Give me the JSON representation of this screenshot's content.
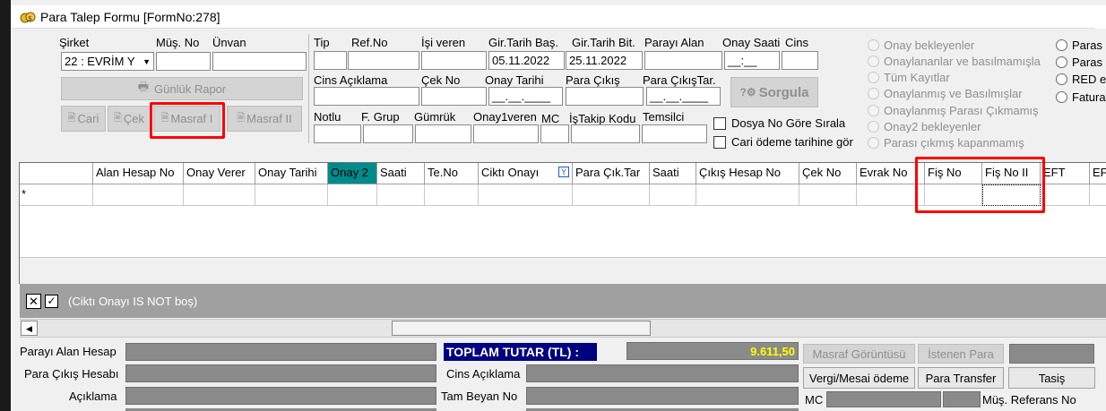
{
  "window": {
    "title": "Para Talep Formu [FormNo:278]"
  },
  "form": {
    "sirket_label": "Şirket",
    "sirket_value": "22 : EVRİM Y",
    "mus_no_label": "Müş. No",
    "unvan_label": "Ünvan",
    "gunluk_rapor": "Günlük Rapor",
    "cari": "Cari",
    "cek": "Çek",
    "masraf1": "Masraf I",
    "masraf2": "Masraf II",
    "tip_label": "Tip",
    "ref_no_label": "Ref.No",
    "isi_veren_label": "İşi veren",
    "gir_tarih_bas_label": "Gir.Tarih Baş.",
    "gir_tarih_bas_value": "05.11.2022",
    "gir_tarih_bit_label": "Gir.Tarih Bit.",
    "gir_tarih_bit_value": "25.11.2022",
    "parayi_alan_label": "Parayı Alan",
    "onay_saati_label": "Onay Saati",
    "onay_saati_value": "__:__",
    "cins_label": "Cins",
    "cins_aciklama_label": "Cins Açıklama",
    "cek_no_label": "Çek No",
    "onay_tarihi_label": "Onay Tarihi",
    "onay_tarihi_value": "__.__.____",
    "para_cikis_label": "Para Çıkış",
    "para_cikis_tar_label": "Para ÇıkışTar.",
    "para_cikis_tar_value": "__.__.____",
    "sorgula": "Sorgula",
    "notlu_label": "Notlu",
    "f_grup_label": "F. Grup",
    "gumruk_label": "Gümrük",
    "onay1veren_label": "Onay1veren",
    "mc_label": "MC",
    "istakip_label": "İşTakip Kodu",
    "temsilci_label": "Temsilci",
    "dosya_no_sirala": "Dosya No Göre Sırala",
    "cari_odeme": "Cari ödeme tarihine gör"
  },
  "radios_left": [
    "Onay bekleyenler",
    "Onaylananlar ve basılmamışla",
    "Tüm Kayıtlar",
    "Onaylanmış ve Basılmışlar",
    "Onaylanmış Parası Çıkmamış",
    "Onay2 bekleyenler",
    "Parası çıkmış kapanmamış"
  ],
  "radios_right": [
    "Paras",
    "Paras",
    "RED e",
    "Fatura"
  ],
  "grid": {
    "columns": [
      "Alan Hesap No",
      "Onay Verer",
      "Onay Tarihi",
      "Onay 2",
      "Saati",
      "Te.No",
      "Ciktı Onayı",
      "Para Çık.Tar",
      "Saati",
      "Çıkış Hesap No",
      "Çek No",
      "Evrak No",
      "Fiş No",
      "Fiş No II",
      "EFT",
      "EF"
    ],
    "new_row_marker": "*",
    "filter_text": "(Ciktı Onayı IS NOT boş)"
  },
  "bottom": {
    "parayi_alan_hesap": "Parayı Alan Hesap",
    "para_cikis_hesabi": "Para Çıkış Hesabı",
    "aciklama": "Açıklama",
    "toplam_tutar_label": "TOPLAM TUTAR (TL) :",
    "toplam_tutar_value": "9.611,50",
    "cins_aciklama": "Cins Açıklama",
    "tam_beyan_no": "Tam Beyan No",
    "masraf_goruntusu": "Masraf Görüntüsü",
    "istenen_para": "İstenen Para",
    "vergi_mesai": "Vergi/Mesai ödeme",
    "para_transfer": "Para Transfer",
    "tasis": "Tasiş",
    "mc": "MC",
    "mus_referans_no": "Müş. Referans No"
  }
}
